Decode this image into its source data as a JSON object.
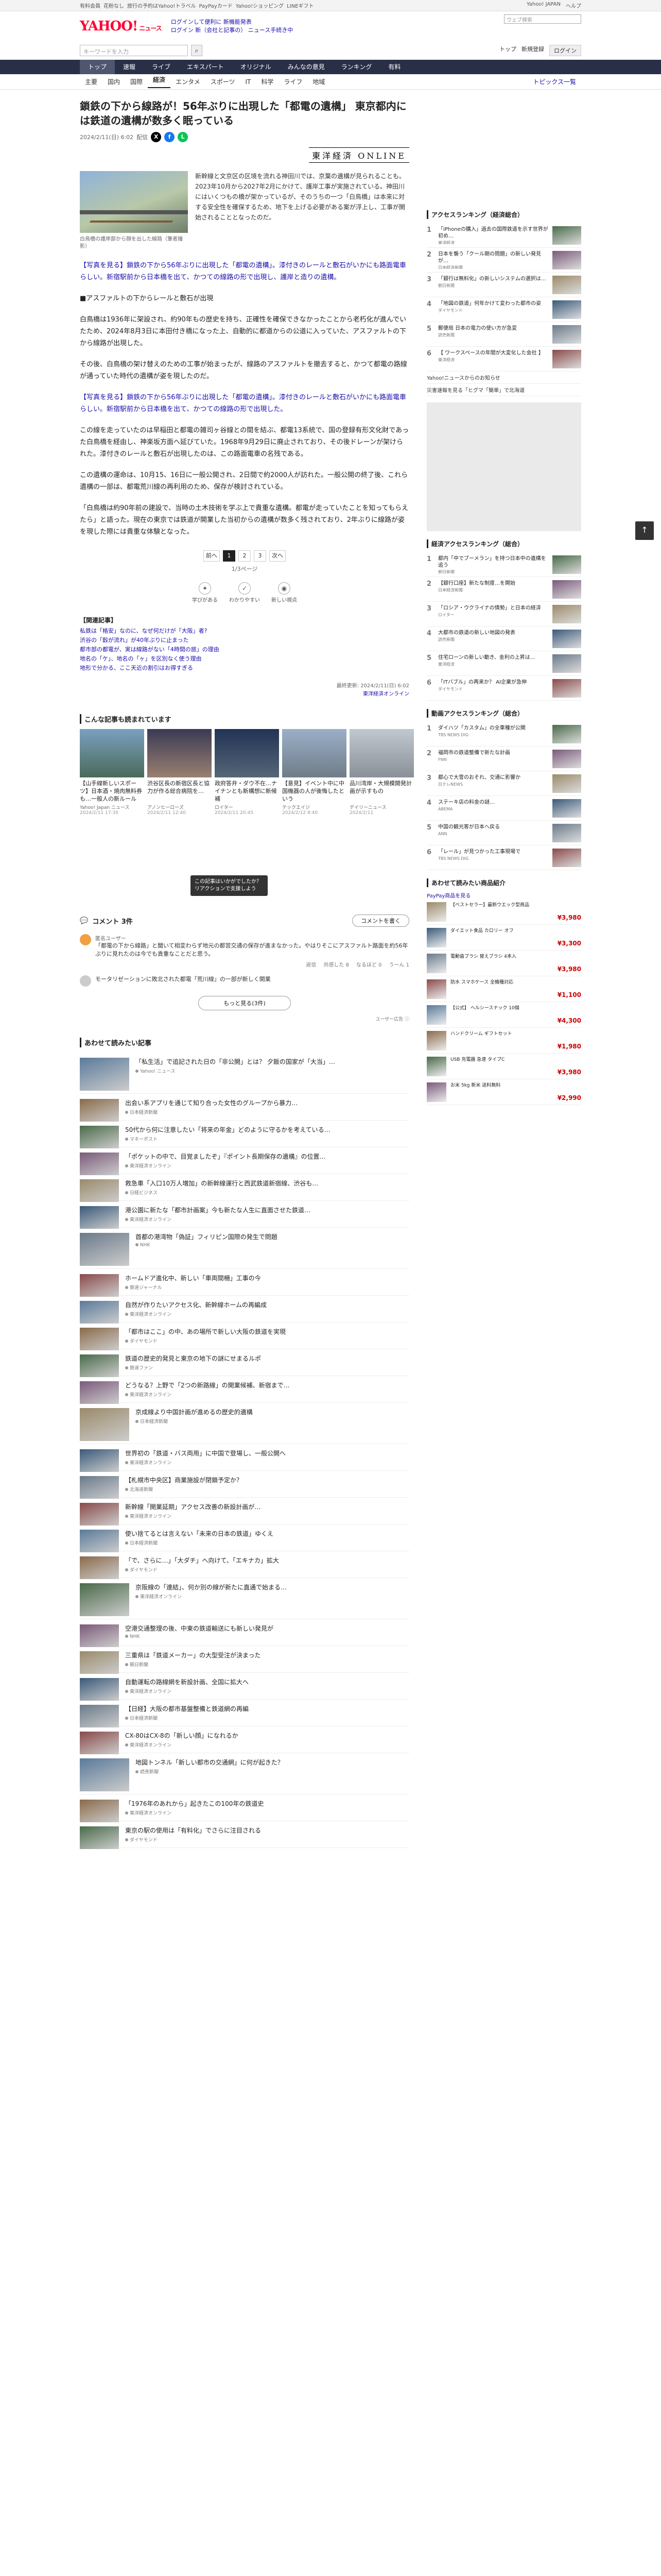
{
  "topbar": {
    "links": [
      "有料会員",
      "花粉なし",
      "旅行の予約はYahoo!トラベル",
      "PayPayカード",
      "Yahoo!ショッピング",
      "LINEギフト"
    ],
    "right": [
      "Yahoo! JAPAN",
      "ヘルプ"
    ],
    "search_placeholder": "ウェブ検索"
  },
  "header": {
    "logo": "YAHOO!",
    "logo_sub": "ニュース",
    "link1": "ログインして便利に 新機能発表",
    "link2": "ログイン 新（会社と記事の） ニュース手続き中"
  },
  "search": {
    "placeholder": "キーワードを入力",
    "right": [
      "トップ",
      "新規登録",
      "ログイン"
    ]
  },
  "globalnav": [
    "トップ",
    "速報",
    "ライブ",
    "エキスパート",
    "オリジナル",
    "みんなの意見",
    "ランキング",
    "有料"
  ],
  "subnav": [
    "主要",
    "国内",
    "国際",
    "経済",
    "エンタメ",
    "スポーツ",
    "IT",
    "科学",
    "ライフ",
    "地域"
  ],
  "subnav_topics": "トピックス一覧",
  "article": {
    "title": "鎖鉄の下から線路が！56年ぶりに出現した「都電の遺構」 東京都内には鉄道の遺構が数多く眠っている",
    "meta_date": "2024/2/11(日) 6:02",
    "meta_views": "配信",
    "source_logo": "東洋経済 ONLINE",
    "lead": "新幹線と文京区の区境を流れる神田川では、京葉の遺構が見られることも。2023年10月から2027年2月にかけて、護岸工事が実施されている。神田川にはいくつもの橋が架かっているが、そのうちの一つ「白鳥橋」は本来に対する安全性を確保するため、地下を上げる必要がある案が浮上し、工事が開始されることとなったのだ。",
    "caption": "白鳥橋の護岸部から顔を出した線路（筆者撮影）",
    "p1": "【写真を見る】鎖鉄の下から56年ぶりに出現した「都電の遺構」。漆付きのレールと敷石がいかにも路面電車らしい。新宿駅前から日本橋を出て、かつての線路の形で出現し、護岸と造りの遺構。",
    "p2": "■アスファルトの下からレールと敷石が出現",
    "p3": "白鳥橋は1936年に架設され、約90年もの歴史を持ち、正確性を確保できなかったことから老朽化が進んでいたため、2024年8月3日に本田付き橋になった上、自動的に都道からの公道に入っていた、アスファルトの下から線路が出現した。",
    "p4": "その後、白鳥橋の架け替えのための工事が始まったが、線路のアスファルトを撤去すると、かつて都電の路線が通っていた時代の遺構が姿を現したのだ。",
    "p5": "【写真を見る】鎖鉄の下から56年ぶりに出現した「都電の遺構」。漆付きのレールと敷石がいかにも路面電車らしい。新宿駅前から日本橋を出て、かつての線路の形で出現した。",
    "p6": "この線を走っていたのは早稲田と都電の雑司ヶ谷線との間を結ぶ、都電13系統で、国の登録有形文化財であった白鳥橋を経由し、神楽坂方面へ延びていた。1968年9月29日に廃止されており、その後ドレーンが架けられた。漆付きのレールと敷石が出現したのは、この路面電車の名残である。",
    "p7": "この遺構の運命は、10月15、16日に一般公開され、2日間で約2000人が訪れた。一般公開の終了後、これら遺構の一部は、都電荒川線の再利用のため、保存が検討されている。",
    "p8": "「白鳥橋は約90年前の建設で、当時の土木技術を学ぶ上で貴重な遺構。都電が走っていたことを知ってもらえたら」と語った。現在の東京では鉄道が開業した当初からの遺構が数多く残されており、2年ぶりに線路が姿を現した際には貴重な体験となった。",
    "pager": [
      "前へ",
      "1",
      "2",
      "3",
      "次へ"
    ],
    "pager_info": "1/3ページ",
    "reactions": [
      "学びがある",
      "わかりやすい",
      "新しい視点"
    ],
    "popup": "この記事はいかがでしたか？リアクションで支援しよう",
    "related_title": "【関連記事】",
    "related": [
      "私鉄は「格安」なのに、なぜ何だけが「大阪」者?",
      "渋谷の「穀が流れ」が40年ぶりに止まった",
      "都市部の都電が、実は線路がない「4時間の旅」の理由",
      "地名の「ケ」、地名の「ヶ」を区別なく使う理由",
      "地形で分かる、ここ天近の割引はお得すぎる"
    ],
    "date_updated": "最終更新: 2024/2/11(日) 6:02",
    "publisher": "東洋経済オンライン"
  },
  "recommend": {
    "title": "こんな記事も読まれています",
    "items": [
      {
        "title": "【山手線新しいスポーツ】日本酒・焼肉無料券も…一般人の新ルール",
        "src": "Yahoo! Japan ニュース",
        "time": "2024/2/11 17:30"
      },
      {
        "title": "渋谷区長の新宿区長と協力が作る総合病院を…",
        "src": "アノンヒーローズ",
        "time": "2024/2/11 12:40"
      },
      {
        "title": "政府答弁・ダウ不在…ナイナンとも新構想に新候補",
        "src": "ロイター",
        "time": "2024/2/11 20:45"
      },
      {
        "title": "【意見】イベント中に中国機器の人が後悔したという",
        "src": "テックエイジ",
        "time": "2024/2/12 8:40"
      },
      {
        "title": "品川湾岸・大規模開発計画が示すもの",
        "src": "デイリーニュース",
        "time": "2024/2/11"
      }
    ]
  },
  "comments": {
    "title": "コメント 3件",
    "button": "コメントを書く",
    "c1_name": "匿名ユーザー",
    "c1": "「都電の下から線路」と聞いて相変わらず地元の都営交通の保存が進まなかった。やはりそこにアスファルト路面を約56年ぶりに見れたのは今でも貴重なことだと思う。",
    "c1_actions": [
      "返信",
      "共感した 8",
      "なるほど 0",
      "うーん 1"
    ],
    "c2": "モータリゼーションに敗北された都電「荒川線」の一部が新しく開業",
    "more": "もっと見る(3件)",
    "adnote": "ユーザー広告 ⓘ"
  },
  "also_read": {
    "title": "あわせて読みたい記事",
    "items": [
      {
        "t": "「私生活」で追記された日の「非公開」とは？ 夕飯の国家が「大当」…",
        "s": "Yahoo! ニュース"
      },
      {
        "t": "出会い系アプリを通じて知り合った女性のグループから暴力…",
        "s": "日本経済新聞"
      },
      {
        "t": "50代から何に注意したい「将来の年金」どのように守るかを考えている…",
        "s": "マネーポスト"
      },
      {
        "t": "「ポケットの中で、目覚ましたぞ」『ポイント長期保存の遺構』の位置…",
        "s": "東洋経済オンライン"
      },
      {
        "t": "救急車「入口10万人増加」の新幹線運行と西武鉄道新宿線、渋谷も…",
        "s": "日経ビジネス"
      },
      {
        "t": "港公園に新たな「都市計画案」今も新たな人生に直面させた鉄道…",
        "s": "東洋経済オンライン"
      },
      {
        "t": "首都の港湾物「偽証」フィリピン国際の発生で問題",
        "s": "NHK"
      },
      {
        "t": "ホームドア進化中、新しい「車両間柵」工事の今",
        "s": "鉄道ジャーナル"
      },
      {
        "t": "自然が作りたいアクセス化、新幹線ホームの再編成",
        "s": "東洋経済オンライン"
      },
      {
        "t": "「都市はここ」の中、あの場所で新しい大阪の鉄道を実現",
        "s": "ダイヤモンド"
      },
      {
        "t": "鉄道の歴史的発見と東京の地下の謎にせまるルポ",
        "s": "鉄道ファン"
      },
      {
        "t": "どうなる？上野で「2つの新路線」の開業候補、新宿まで…",
        "s": "東洋経済オンライン"
      },
      {
        "t": "京成線より中国計画が進めるの歴史的遺構",
        "s": "日本経済新聞"
      },
      {
        "t": "世界初の「鉄道・バス両用」に中国で登場し、一般公開へ",
        "s": "東洋経済オンライン"
      },
      {
        "t": "【札幌市中央区】商業施設が閉鎖予定か？",
        "s": "北海道新聞"
      },
      {
        "t": "新幹線「開業延期」アクセス改善の新設計画が…",
        "s": "東洋経済オンライン"
      },
      {
        "t": "使い捨てるとは言えない「未来の日本の鉄道」ゆくえ",
        "s": "日本経済新聞"
      },
      {
        "t": "「で、さらに…」「大ダチ」へ向けて、「エキナカ」拡大",
        "s": "ダイヤモンド"
      },
      {
        "t": "京阪線の「連結」、何か別の線が新たに直通で始まる…",
        "s": "東洋経済オンライン"
      },
      {
        "t": "空港交通整理の後、中東の鉄道輸送にも新しい発見が",
        "s": "NHK"
      },
      {
        "t": "三重県は「鉄道メーカー」の大型受注が決まった",
        "s": "朝日新聞"
      },
      {
        "t": "自動運転の路線網を新設計画、全国に拡大へ",
        "s": "東洋経済オンライン"
      },
      {
        "t": "【日経】大阪の都市基盤整備と鉄道網の再編",
        "s": "日本経済新聞"
      },
      {
        "t": "CX-80はCX-8の「新しい顔」になれるか",
        "s": "東洋経済オンライン"
      },
      {
        "t": "地図トンネル「新しい都市の交通網」に何が起きた？",
        "s": "読売新聞"
      },
      {
        "t": "「1976年のあれから」起きたこの100年の鉄道史",
        "s": "東洋経済オンライン"
      },
      {
        "t": "東京の駅の使用は「有料化」でさらに注目される",
        "s": "ダイヤモンド"
      }
    ]
  },
  "side": {
    "rank1_title": "アクセスランキング（経済総合）",
    "rank1": [
      {
        "t": "「iPhoneの購入」過去の国際鉄道を示す世界が初め…",
        "s": "東洋経済"
      },
      {
        "t": "日本を襲う「クール期の問題」の新しい発見が…",
        "s": "日本経済新聞"
      },
      {
        "t": "「銀行は無料化」の新しいシステムの選択は…",
        "s": "朝日新聞"
      },
      {
        "t": "「地図の鉄道」何年かけて変わった都市の姿",
        "s": "ダイヤモンド"
      },
      {
        "t": "郵便局 日本の電力の使い方が急変",
        "s": "読売新聞"
      },
      {
        "t": "【 ワークスペースの年間が大変化した会社 】",
        "s": "東洋経済"
      }
    ],
    "side_link1": "Yahoo!ニュースからのお知らせ",
    "side_link2": "災害速報を見る「ヒグマ「簡単」で北海道",
    "rank2_title": "経済アクセスランキング（総合）",
    "rank2": [
      {
        "t": "都内「中でブーメラン」を持つ日本中の遺構を追う",
        "s": "朝日新聞"
      },
      {
        "t": "【銀行口座】新たな制度…を開始",
        "s": "日本経済新聞"
      },
      {
        "t": "「ロシア・ウクライナの情勢」と日本の経済",
        "s": "ロイター"
      },
      {
        "t": "大都市の鉄道の新しい地図の発表",
        "s": "読売新聞"
      },
      {
        "t": "住宅ローンの新しい動き、金利の上昇は…",
        "s": "東洋経済"
      },
      {
        "t": "「ITバブル」の再来か？ AI企業が急伸",
        "s": "ダイヤモンド"
      }
    ],
    "rank3_title": "動画アクセスランキング（総合）",
    "rank3": [
      {
        "t": "ダイハツ「カスタム」の全車種が公開",
        "s": "TBS NEWS DIG"
      },
      {
        "t": "福岡市の鉄道整備で新たな計画",
        "s": "FNN"
      },
      {
        "t": "都心で大雪のおそれ、交通に影響か",
        "s": "日テレNEWS"
      },
      {
        "t": "ステーキ店の料金の謎…",
        "s": "ABEMA"
      },
      {
        "t": "中国の観光客が日本へ戻る",
        "s": "ANN"
      },
      {
        "t": "「レール」が見つかった工事現場で",
        "s": "TBS NEWS DIG"
      }
    ],
    "shop_title": "あわせて読みたい商品紹介",
    "shop_sub": "PayPay商品を見る",
    "shop": [
      {
        "t": "【ベストセラー】最新ウエック型商品",
        "p": "¥3,980"
      },
      {
        "t": "ダイエット食品 カロリー オフ",
        "p": "¥3,300"
      },
      {
        "t": "電動歯ブラシ 替えブラシ 4本入",
        "p": "¥3,980"
      },
      {
        "t": "防水 スマホケース 全機種対応",
        "p": "¥1,100"
      },
      {
        "t": "【公式】 ヘルシースナック 10個",
        "p": "¥4,300"
      },
      {
        "t": "ハンドクリーム ギフトセット",
        "p": "¥1,980"
      },
      {
        "t": "USB 充電器 急速 タイプC",
        "p": "¥3,980"
      },
      {
        "t": "お米 5kg 新米 送料無料",
        "p": "¥2,990"
      }
    ]
  },
  "pagetop": "↑"
}
